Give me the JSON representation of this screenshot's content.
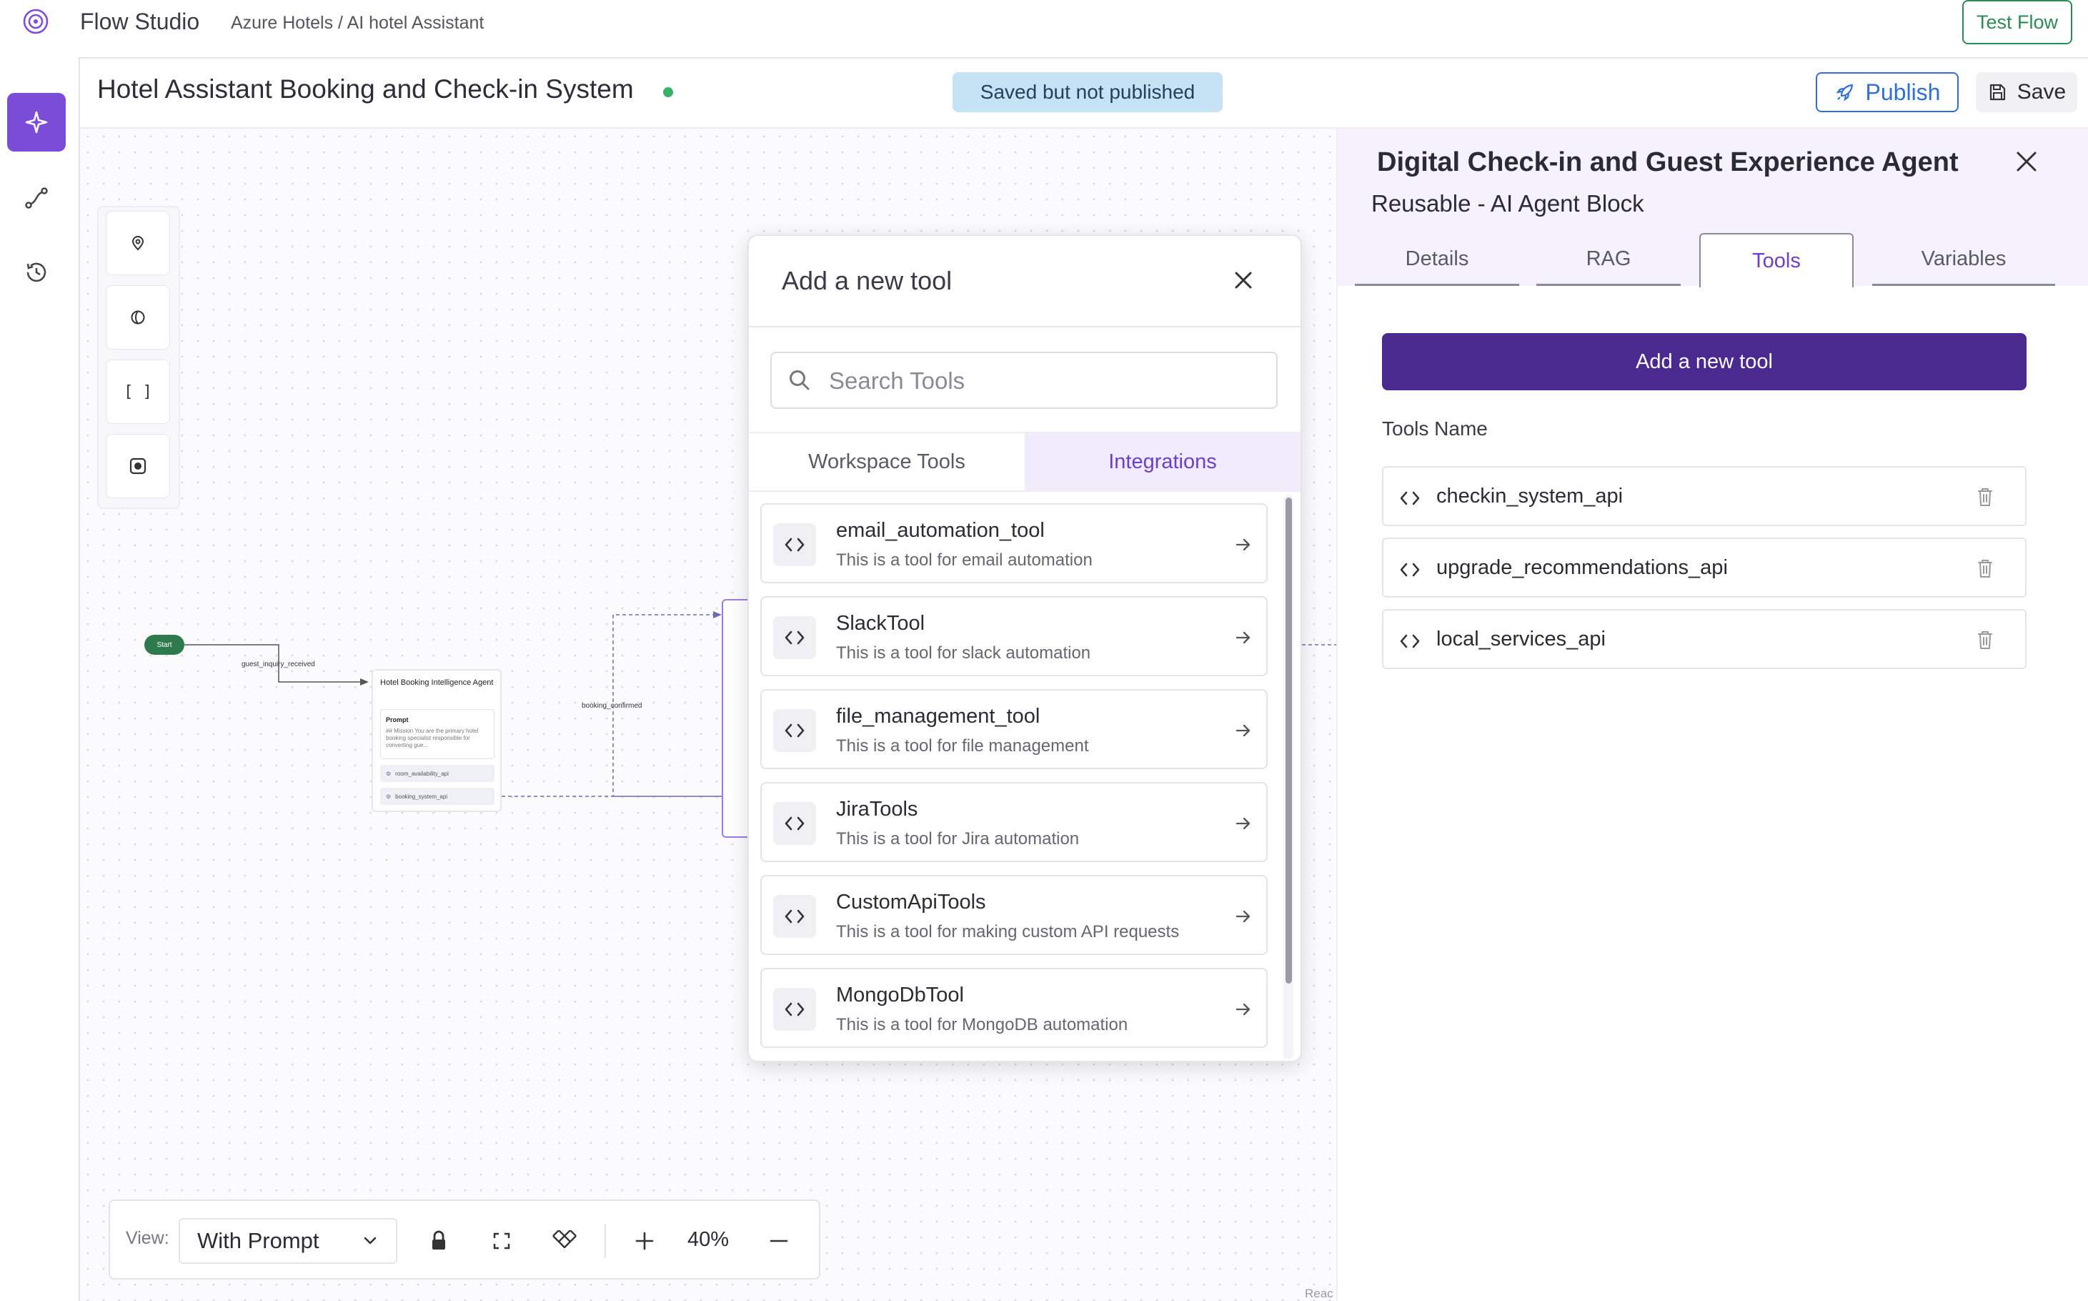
{
  "app": {
    "title": "Flow Studio",
    "breadcrumb": "Azure Hotels / AI hotel Assistant",
    "test_flow_label": "Test Flow",
    "logo_icon": "spiral-logo-icon"
  },
  "rail": {
    "items": [
      {
        "icon": "sparkle-icon",
        "active": true
      },
      {
        "icon": "flow-path-icon",
        "active": false
      },
      {
        "icon": "history-icon",
        "active": false
      }
    ]
  },
  "flow": {
    "title": "Hotel Assistant Booking and Check-in System",
    "status_badge": "Saved but not published",
    "publish_label": "Publish",
    "save_label": "Save"
  },
  "canvas": {
    "side_tools": [
      "pin-icon",
      "globe-icon",
      "bracket-icon",
      "record-icon"
    ],
    "bracket_glyph": "[ ]",
    "start_label": "Start",
    "edge_labels": [
      "guest_inquiry_received",
      "booking_confirmed"
    ],
    "node": {
      "title": "Hotel Booking Intelligence Agent",
      "prompt_label": "Prompt",
      "prompt_text": "## Mission You are the primary hotel booking specialist responsible for converting gue...",
      "tools": [
        "room_availability_api",
        "booking_system_api"
      ]
    },
    "attribution": "Reac"
  },
  "modal": {
    "title": "Add a new tool",
    "search_placeholder": "Search Tools",
    "tabs": {
      "workspace": "Workspace Tools",
      "integrations": "Integrations"
    },
    "active_tab": "Integrations",
    "tools": [
      {
        "name": "email_automation_tool",
        "desc": "This is a tool for email automation"
      },
      {
        "name": "SlackTool",
        "desc": "This is a tool for slack automation"
      },
      {
        "name": "file_management_tool",
        "desc": "This is a tool for file management"
      },
      {
        "name": "JiraTools",
        "desc": "This is a tool for Jira automation"
      },
      {
        "name": "CustomApiTools",
        "desc": "This is a tool for making custom API requests"
      },
      {
        "name": "MongoDbTool",
        "desc": "This is a tool for MongoDB automation"
      }
    ]
  },
  "panel": {
    "title": "Digital Check-in and Guest Experience Agent",
    "subtitle": "Reusable - AI Agent Block",
    "tabs": {
      "details": "Details",
      "rag": "RAG",
      "tools": "Tools",
      "variables": "Variables"
    },
    "active_tab": "Tools",
    "add_tool_label": "Add a new tool",
    "tools_name_label": "Tools Name",
    "tools": [
      "checkin_system_api",
      "upgrade_recommendations_api",
      "local_services_api"
    ]
  },
  "controls": {
    "view_label": "View:",
    "view_value": "With Prompt",
    "zoom": "40%"
  },
  "colors": {
    "accent": "#6b3fc8",
    "primary_button": "#4a2a8f",
    "publish": "#2f6fd6",
    "test_flow": "#2f8a55",
    "status_badge_bg": "#c6e3f6",
    "status_dot": "#39b16a"
  }
}
